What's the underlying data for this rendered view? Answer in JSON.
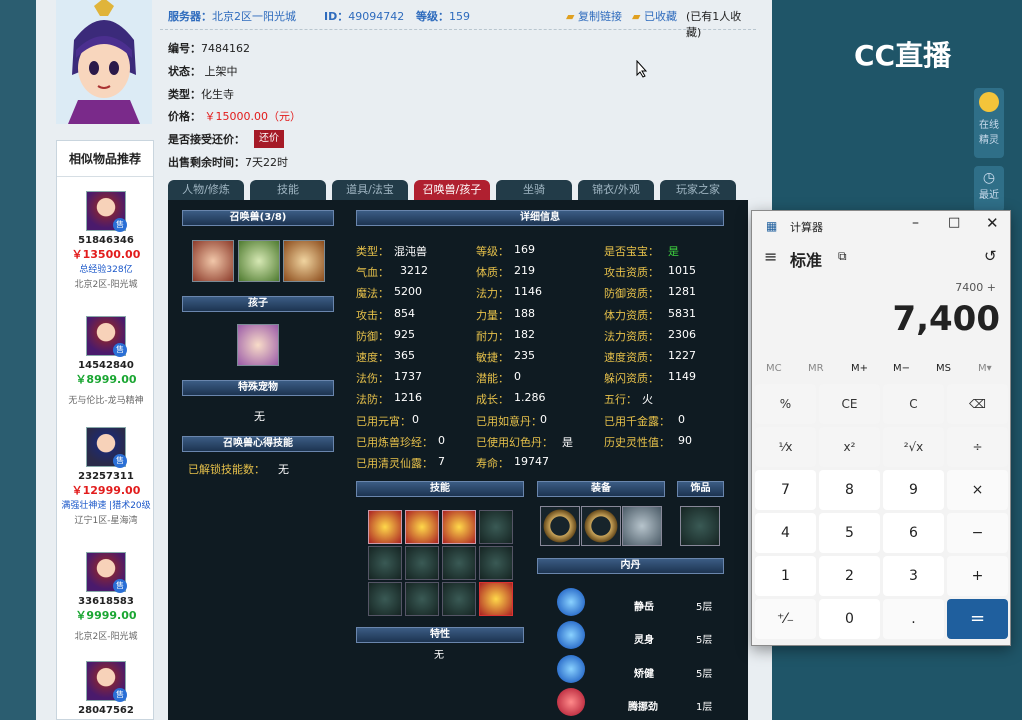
{
  "header": {
    "server_label": "服务器：",
    "server_value": "北京2区一阳光城",
    "id_label": "ID：",
    "id_value": "49094742",
    "level_label": "等级：",
    "level_value": "159",
    "copy_link": "复制链接",
    "favorited": "已收藏",
    "fav_count": "(已有1人收藏)"
  },
  "info": {
    "number_label": "编号：",
    "number_value": "7484162",
    "status_label": "状态：",
    "status_value": "上架中",
    "type_label": "类型：",
    "type_value": "化生寺",
    "price_label": "价格：",
    "price_value": "￥15000.00（元）",
    "bargain_label": "是否接受还价：",
    "bargain_button": "还价",
    "remaining_label": "出售剩余时间：",
    "remaining_value": "7天22时"
  },
  "tabs": [
    "人物/修炼",
    "技能",
    "道具/法宝",
    "召唤兽/孩子",
    "坐骑",
    "锦衣/外观",
    "玩家之家"
  ],
  "similar": {
    "title": "相似物品推荐",
    "items": [
      {
        "id": "51846346",
        "price": "￥13500.00",
        "sub": "总经验328亿",
        "server": "北京2区-阳光城",
        "price_color": "red"
      },
      {
        "id": "14542840",
        "price": "￥8999.00",
        "sub": "",
        "server": "无与伦比-龙马精神",
        "price_color": "green"
      },
      {
        "id": "23257311",
        "price": "￥12999.00",
        "sub": "满强壮神速 |猎术20级",
        "server": "辽宁1区-星海湾",
        "price_color": "red"
      },
      {
        "id": "33618583",
        "price": "￥9999.00",
        "sub": "",
        "server": "北京2区-阳光城",
        "price_color": "green"
      },
      {
        "id": "28047562",
        "price": "",
        "sub": "",
        "server": "",
        "price_color": "red"
      }
    ],
    "sell_tag": "售"
  },
  "panel": {
    "summon_header": "召唤兽(3/8)",
    "child_header": "孩子",
    "special_header": "特殊宠物",
    "special_value": "无",
    "heart_header": "召唤兽心得技能",
    "unlocked_label": "已解锁技能数：",
    "unlocked_value": "无",
    "detail_header": "详细信息",
    "skills_header": "技能",
    "equip_header": "装备",
    "ornament_header": "饰品",
    "trait_header": "特性",
    "trait_value": "无",
    "neidan_header": "内丹",
    "neidan": [
      {
        "name": "静岳",
        "level": "5层"
      },
      {
        "name": "灵身",
        "level": "5层"
      },
      {
        "name": "矫健",
        "level": "5层"
      },
      {
        "name": "腾挪劲",
        "level": "1层"
      }
    ]
  },
  "stats": {
    "col1": [
      {
        "label": "类型：",
        "value": "混沌兽"
      },
      {
        "label": "气血：",
        "value": "3212"
      },
      {
        "label": "魔法：",
        "value": "5200"
      },
      {
        "label": "攻击：",
        "value": "854"
      },
      {
        "label": "防御：",
        "value": "925"
      },
      {
        "label": "速度：",
        "value": "365"
      },
      {
        "label": "法伤：",
        "value": "1737"
      },
      {
        "label": "法防：",
        "value": "1216"
      },
      {
        "label": "已用元宵：",
        "value": "0"
      },
      {
        "label": "已用炼兽珍经：",
        "value": "0"
      },
      {
        "label": "已用清灵仙露：",
        "value": "7"
      }
    ],
    "col2": [
      {
        "label": "等级：",
        "value": "169"
      },
      {
        "label": "体质：",
        "value": "219"
      },
      {
        "label": "法力：",
        "value": "1146"
      },
      {
        "label": "力量：",
        "value": "188"
      },
      {
        "label": "耐力：",
        "value": "182"
      },
      {
        "label": "敏捷：",
        "value": "235"
      },
      {
        "label": "潜能：",
        "value": "0"
      },
      {
        "label": "成长：",
        "value": "1.286"
      },
      {
        "label": "已用如意丹：",
        "value": "0"
      },
      {
        "label": "已使用幻色丹：",
        "value": "是"
      },
      {
        "label": "寿命：",
        "value": "19747"
      }
    ],
    "col3": [
      {
        "label": "是否宝宝：",
        "value": "是"
      },
      {
        "label": "攻击资质：",
        "value": "1015"
      },
      {
        "label": "防御资质：",
        "value": "1281"
      },
      {
        "label": "体力资质：",
        "value": "5831"
      },
      {
        "label": "法力资质：",
        "value": "2306"
      },
      {
        "label": "速度资质：",
        "value": "1227"
      },
      {
        "label": "躲闪资质：",
        "value": "1149"
      },
      {
        "label": "五行：",
        "value": "火"
      },
      {
        "label": "已用千金露：",
        "value": "0"
      },
      {
        "label": "历史灵性值：",
        "value": "90"
      }
    ]
  },
  "calculator": {
    "title": "计算器",
    "mode": "标准",
    "expression": "7400 +",
    "display": "7,400",
    "memory": [
      "MC",
      "MR",
      "M+",
      "M−",
      "MS",
      "M▾"
    ],
    "keys": [
      "%",
      "CE",
      "C",
      "⌫",
      "¹⁄x",
      "x²",
      "²√x",
      "÷",
      "7",
      "8",
      "9",
      "×",
      "4",
      "5",
      "6",
      "−",
      "1",
      "2",
      "3",
      "+",
      "⁺⁄₋",
      "0",
      ".",
      "="
    ]
  },
  "right": {
    "logo": "CC直播",
    "online_label": "在线\n精灵",
    "recent_label": "最近"
  }
}
